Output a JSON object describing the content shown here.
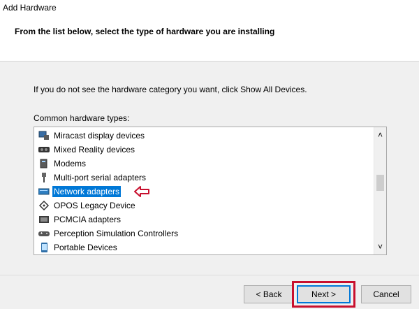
{
  "window": {
    "title": "Add Hardware"
  },
  "header": {
    "title": "From the list below, select the type of hardware you are installing"
  },
  "body": {
    "instruction": "If you do not see the hardware category you want, click Show All Devices.",
    "list_label": "Common hardware types:"
  },
  "list": {
    "items": [
      {
        "label": "Miracast display devices",
        "icon": "miracast-icon"
      },
      {
        "label": "Mixed Reality devices",
        "icon": "mixed-reality-icon"
      },
      {
        "label": "Modems",
        "icon": "modem-icon"
      },
      {
        "label": "Multi-port serial adapters",
        "icon": "serial-port-icon"
      },
      {
        "label": "Network adapters",
        "icon": "network-adapter-icon",
        "selected": true
      },
      {
        "label": "OPOS Legacy Device",
        "icon": "opos-device-icon"
      },
      {
        "label": "PCMCIA adapters",
        "icon": "pcmcia-icon"
      },
      {
        "label": "Perception Simulation Controllers",
        "icon": "perception-controller-icon"
      },
      {
        "label": "Portable Devices",
        "icon": "portable-device-icon"
      }
    ],
    "selection_color": "#0078d7",
    "scroll_up": "˄",
    "scroll_down": "˅"
  },
  "buttons": {
    "back": "< Back",
    "next": "Next >",
    "cancel": "Cancel"
  },
  "annotations": {
    "highlight_color": "#c8102e"
  }
}
